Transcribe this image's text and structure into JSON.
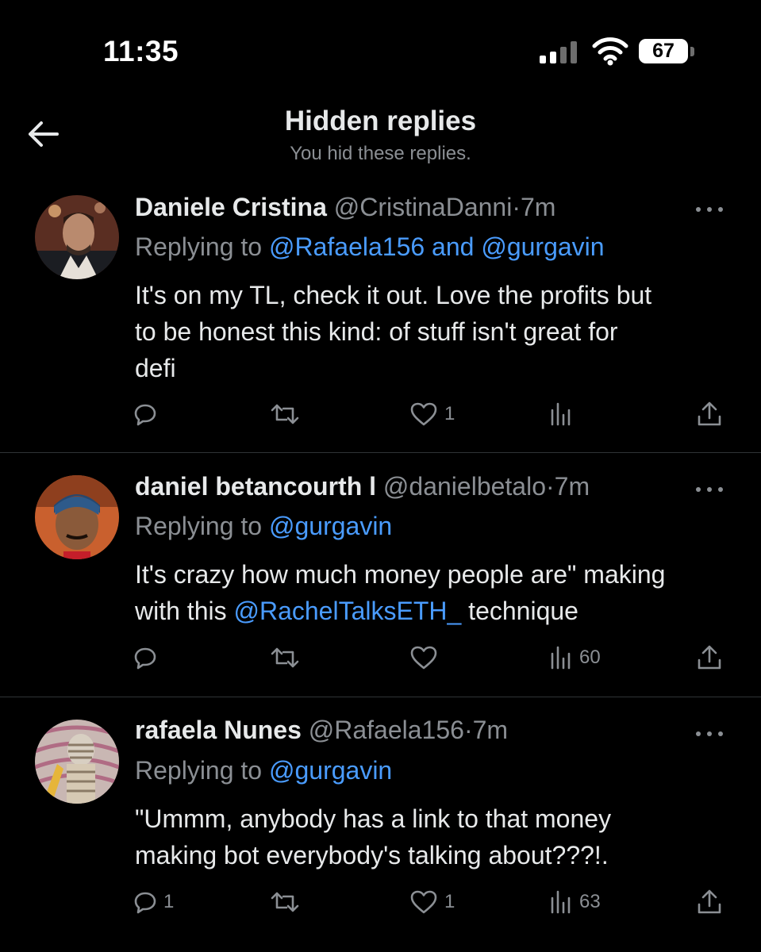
{
  "status_bar": {
    "time": "11:35",
    "battery": "67"
  },
  "header": {
    "title": "Hidden replies",
    "subtitle": "You hid these replies."
  },
  "replies": [
    {
      "name": "Daniele Cristina",
      "handle": "@CristinaDanni",
      "separator": "·",
      "age": "7m",
      "replying_prefix": "Replying to ",
      "mentions": "@Rafaela156 and @gurgavin",
      "body_lines": [
        "It's on my TL, check it out. Love the profits but",
        "to be honest this kind: of stuff isn't great for",
        "defi"
      ],
      "counts": {
        "reply": "",
        "repost": "",
        "like": "1",
        "views": ""
      }
    },
    {
      "name": "daniel betancourth l",
      "handle": "@danielbetalo",
      "separator": "·",
      "age": "7m",
      "replying_prefix": "Replying to ",
      "mentions": "@gurgavin",
      "body_pre": "It's crazy how much money people are\" making",
      "body_line2_pre": "with this ",
      "body_mention": "@RachelTalksETH_",
      "body_line2_post": " technique",
      "counts": {
        "reply": "",
        "repost": "",
        "like": "",
        "views": "60"
      }
    },
    {
      "name": "rafaela Nunes",
      "handle": "@Rafaela156",
      "separator": "·",
      "age": "7m",
      "replying_prefix": "Replying to ",
      "mentions": "@gurgavin",
      "body_lines": [
        "\"Ummm, anybody has a link to that money",
        "making bot everybody's talking about???!."
      ],
      "counts": {
        "reply": "1",
        "repost": "",
        "like": "1",
        "views": "63"
      }
    }
  ],
  "icons": {
    "back": "arrow-left-icon",
    "more": "more-horizontal-icon",
    "reply": "reply-icon",
    "repost": "repost-icon",
    "like": "heart-icon",
    "views": "views-icon",
    "share": "share-icon"
  },
  "colors": {
    "background": "#000000",
    "text": "#e7e9ea",
    "muted": "#8b8f94",
    "link": "#4a9cff",
    "divider": "#2f3336"
  }
}
